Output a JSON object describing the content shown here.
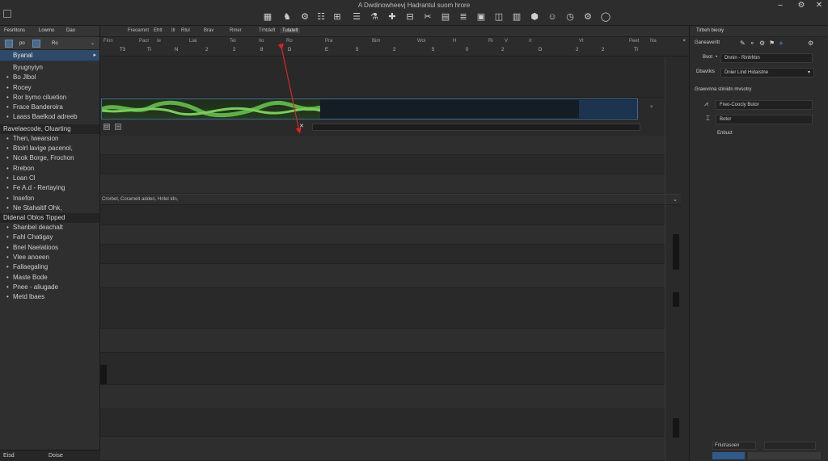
{
  "window": {
    "title": "A Dwdinowheevj Hadrantul suom hrore"
  },
  "toolbar": {
    "icons": [
      "grid-icon",
      "figure-icon",
      "gear-icon",
      "sliders-icon",
      "grid-small-icon",
      "scissors-icon",
      "bookmark-icon",
      "monitor-icon",
      "panel-icon",
      "layout-icon",
      "shield-icon",
      "smiley-icon",
      "clock-icon",
      "settings-icon"
    ]
  },
  "left_panel": {
    "tabs": [
      "Fesrlitons",
      "Lowmo",
      "Dao"
    ],
    "tools": [
      "po",
      "Ro"
    ],
    "selected": {
      "label": "Byanal",
      "arrow": "▸"
    },
    "items1": [
      "Byugnyiyn",
      "Bo Jlbol",
      "Rocey",
      "Ror bymo ciluetion",
      "Frace Banderoira",
      "Laass Baelkod adreeb"
    ],
    "group1": "Ravelaecode, Oluarting",
    "items2": [
      "Then, lwearsion",
      "Btolrl lavige pacenol,",
      "Ncok Borge, Frochon",
      "Rrebon",
      "Loan Cl",
      "Fe A.d - Rertaying",
      "Insefon",
      "Ne Stahaitif Ohk,"
    ],
    "group2": "Didenal Oblos Tipped",
    "items3": [
      "Shanbel deachalt",
      "Fahl Chatigay",
      "Bnel Naelatioos",
      "Vlee anoeen",
      "Fallaegaling",
      "Maste Bode",
      "Pnee - aliugade",
      "Metd lbaes"
    ],
    "footer": [
      "Eisd",
      "Doise"
    ]
  },
  "center": {
    "tabs": [
      "Freoarnnt",
      "Ehtt",
      "Ilr",
      "Rtul",
      "Brav",
      "Rmer",
      "Trhtdeft"
    ],
    "active_tab": "Tulatelt",
    "ruler_labels": [
      "Finn",
      "Pacr",
      "Ie",
      "Liai",
      "Tei",
      "Ilo",
      "Ro",
      "Pra",
      "Bim",
      "Wol",
      "H",
      "Ri",
      "V",
      "Ir",
      "Vt",
      "Peet",
      "Na"
    ],
    "ruler_numbers": [
      "T3",
      "Ti",
      "N",
      "2",
      "2",
      "8",
      "D",
      "E",
      "5",
      "2",
      "5",
      "0",
      "2",
      "D",
      "2",
      "2",
      "Ti"
    ],
    "close_x": "×",
    "wave_x": "×",
    "scrub_mark": "✕",
    "section_label": "Crorbel, Coramelt adden, Hrilel Idn,"
  },
  "right_panel": {
    "header": "Tirbeh bieoiy",
    "row1": {
      "label": "Ganeaveritt",
      "field": ""
    },
    "row2": {
      "label": "Bvot",
      "field": "Dnnin - Rinhfrbn"
    },
    "row3": {
      "label": "Dbavtkis",
      "field": "Dnier Lind Hidaistne"
    },
    "section": "Grawvnna stiniidn mvsotry",
    "list": [
      {
        "icon": "wave-icon",
        "label": "Freo-Coociy Butor"
      },
      {
        "icon": "bracket-icon",
        "label": "Botor"
      },
      {
        "icon": "",
        "label": "Enbuct"
      }
    ],
    "footer_label": "Frlutrasoen"
  }
}
